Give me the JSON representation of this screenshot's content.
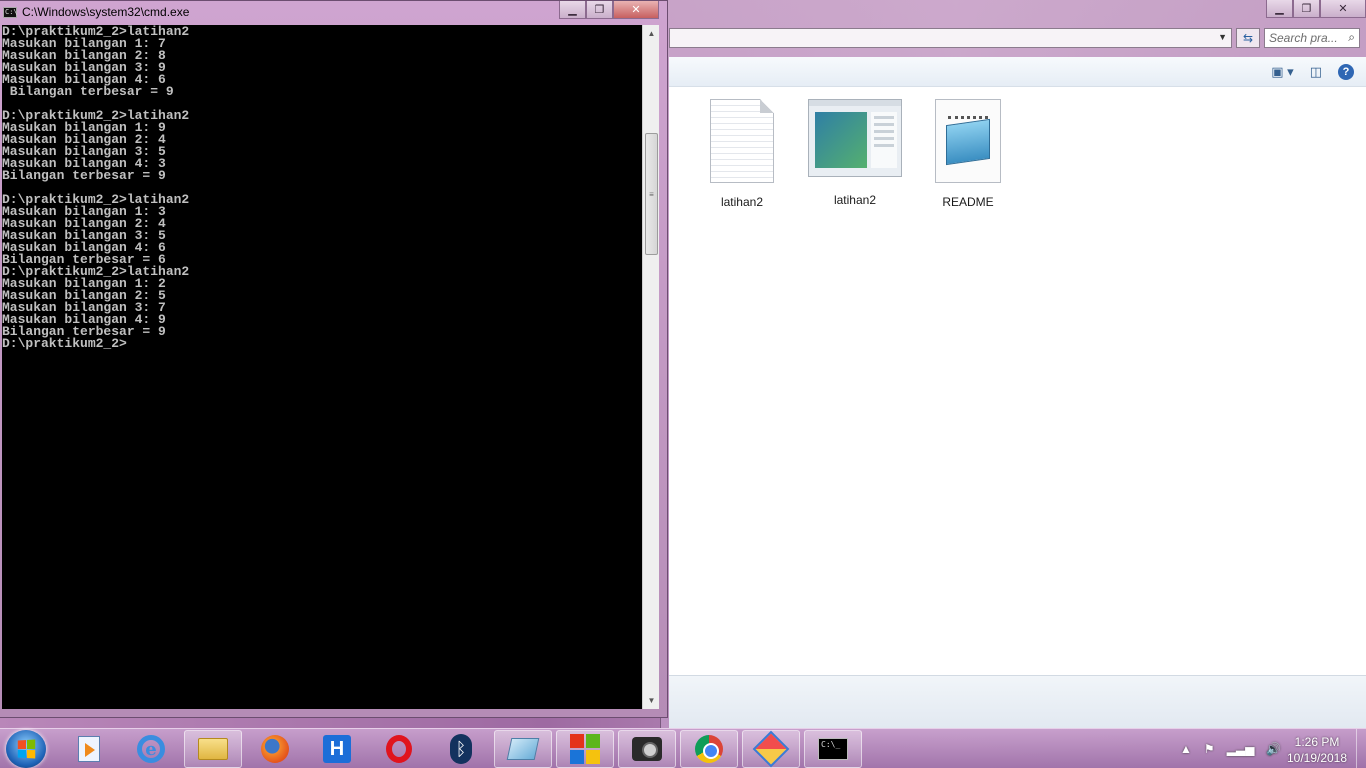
{
  "cmd_window": {
    "title": "C:\\Windows\\system32\\cmd.exe",
    "icon": "cmd-app-icon",
    "icon_text": "C:\\",
    "caption_buttons": [
      "minimize",
      "maximize",
      "close"
    ],
    "console_lines": [
      "D:\\praktikum2_2>latihan2",
      "Masukan bilangan 1: 7",
      "Masukan bilangan 2: 8",
      "Masukan bilangan 3: 9",
      "Masukan bilangan 4: 6",
      " Bilangan terbesar = 9",
      "",
      "D:\\praktikum2_2>latihan2",
      "Masukan bilangan 1: 9",
      "Masukan bilangan 2: 4",
      "Masukan bilangan 3: 5",
      "Masukan bilangan 4: 3",
      "Bilangan terbesar = 9",
      "",
      "D:\\praktikum2_2>latihan2",
      "Masukan bilangan 1: 3",
      "Masukan bilangan 2: 4",
      "Masukan bilangan 3: 5",
      "Masukan bilangan 4: 6",
      "Bilangan terbesar = 6",
      "D:\\praktikum2_2>latihan2",
      "Masukan bilangan 1: 2",
      "Masukan bilangan 2: 5",
      "Masukan bilangan 3: 7",
      "Masukan bilangan 4: 9",
      "Bilangan terbesar = 9",
      "D:\\praktikum2_2>"
    ]
  },
  "explorer": {
    "search_placeholder": "Search pra...",
    "files": [
      {
        "name": "latihan2",
        "icon": "text-document-icon"
      },
      {
        "name": "latihan2",
        "icon": "application-exe-icon"
      },
      {
        "name": "README",
        "icon": "notepad-document-icon"
      }
    ]
  },
  "taskbar": {
    "apps": [
      "windows-media-player-icon",
      "internet-explorer-icon",
      "windows-explorer-icon",
      "firefox-icon",
      "h-app-icon",
      "opera-icon",
      "bluetooth-icon",
      "editor-icon",
      "windows-app-icon",
      "camera-app-icon",
      "chrome-icon",
      "diamond-app-icon",
      "command-prompt-icon"
    ],
    "cmd_icon_text": "C:\\_",
    "clock": {
      "time": "1:26 PM",
      "date": "10/19/2018"
    }
  }
}
